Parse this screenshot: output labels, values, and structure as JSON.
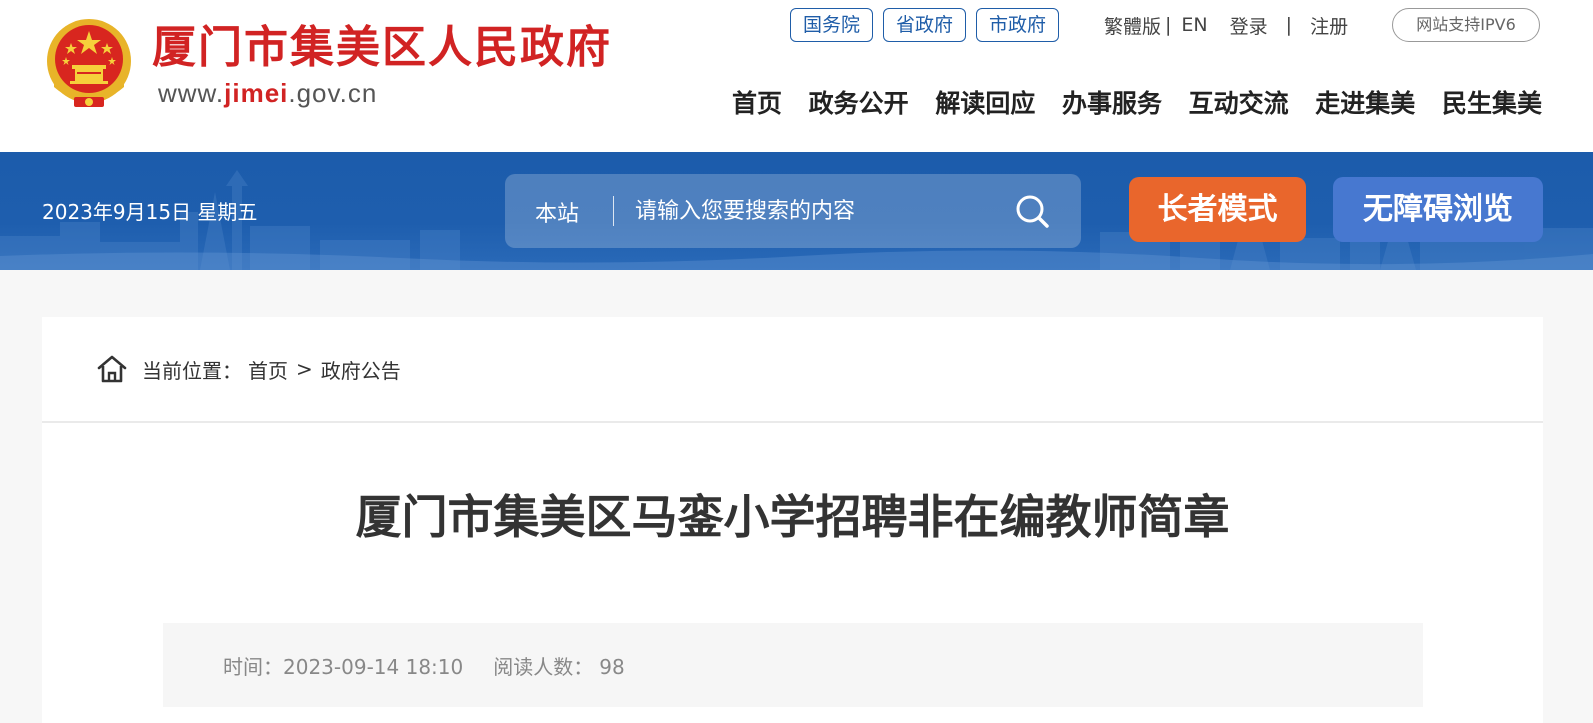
{
  "header": {
    "site_title": "厦门市集美区人民政府",
    "url_prefix": "www.",
    "url_highlight": "jimei",
    "url_suffix": ".gov.cn",
    "gov_links": [
      "国务院",
      "省政府",
      "市政府"
    ],
    "utils": {
      "traditional": "繁體版",
      "english": "EN",
      "login": "登录",
      "register": "注册",
      "separator": "|"
    },
    "ipv6": "网站支持IPV6",
    "nav": [
      "首页",
      "政务公开",
      "解读回应",
      "办事服务",
      "互动交流",
      "走进集美",
      "民生集美"
    ]
  },
  "banner": {
    "date": "2023年9月15日 星期五",
    "search": {
      "scope": "本站",
      "placeholder": "请输入您要搜索的内容",
      "icon": "search-icon"
    },
    "elder_mode": "长者模式",
    "accessible": "无障碍浏览"
  },
  "content": {
    "breadcrumb": {
      "icon": "home-icon",
      "label": "当前位置：",
      "items": [
        "首页",
        "政府公告"
      ],
      "separator": ">"
    },
    "title": "厦门市集美区马銮小学招聘非在编教师简章",
    "meta": {
      "time_label": "时间：",
      "time_value": "2023-09-14 18:10",
      "reads_label": "阅读人数：",
      "reads_value": "98"
    }
  },
  "colors": {
    "brand_red": "#d12323",
    "banner_blue": "#1c5cab",
    "elder_orange": "#e9662c",
    "access_blue": "#4778d0"
  }
}
